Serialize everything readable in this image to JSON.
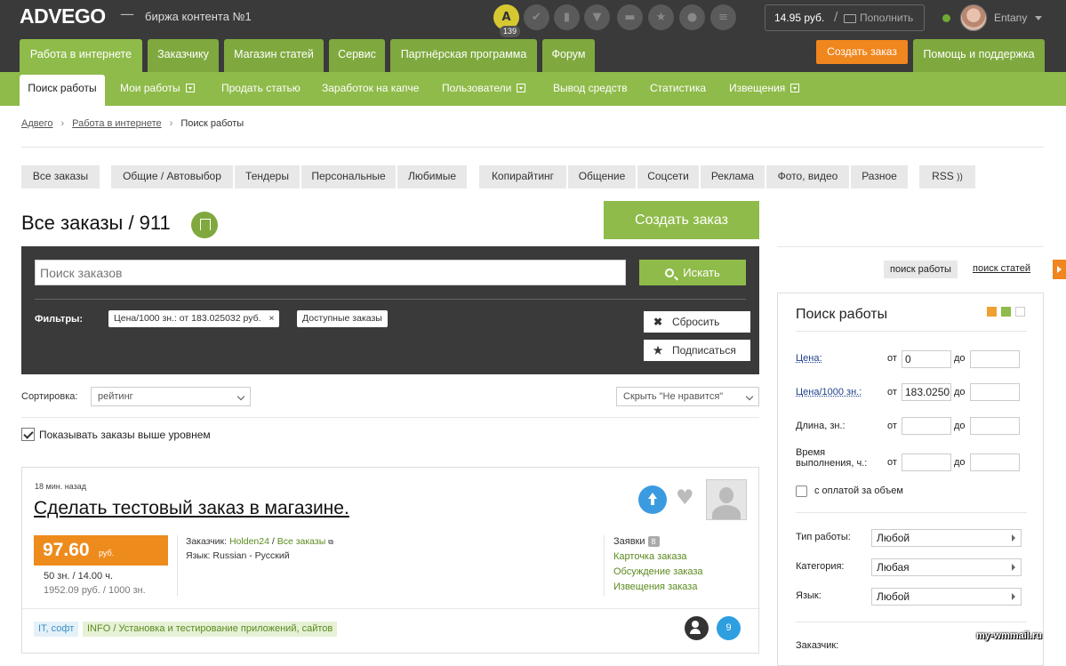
{
  "header": {
    "logo": "ADVEGO",
    "dash": "—",
    "tagline": "биржа контента №1",
    "notification_count": "139",
    "balance": "14.95 руб.",
    "balance_sep": "/",
    "topup_label": "Пополнить",
    "username": "Entany",
    "icons": [
      "doc-icon",
      "check-icon",
      "file-icon",
      "cart-icon",
      "folder-icon",
      "star-icon",
      "chat-icon",
      "list-icon"
    ]
  },
  "main_tabs": [
    "Работа в интернете",
    "Заказчику",
    "Магазин статей",
    "Сервис",
    "Партнёрская программа",
    "Форум"
  ],
  "create_order_top": "Создать заказ",
  "help_tab": "Помощь и поддержка",
  "subnav": [
    "Поиск работы",
    "Мои работы",
    "Продать статью",
    "Заработок на капче",
    "Пользователи",
    "Вывод средств",
    "Статистика",
    "Извещения"
  ],
  "breadcrumb": [
    "Адвего",
    "Работа в интернете",
    "Поиск работы"
  ],
  "breadcrumb_sep": "›",
  "filter_buttons": {
    "all": "Все заказы",
    "group1": [
      "Общие / Автовыбор",
      "Тендеры",
      "Персональные",
      "Любимые"
    ],
    "group2": [
      "Копирайтинг",
      "Общение",
      "Соцсети",
      "Реклама",
      "Фото, видео",
      "Разное"
    ],
    "rss": "RSS"
  },
  "page_title": "Все заказы / 911",
  "create_order_button": "Создать заказ",
  "search": {
    "placeholder": "Поиск заказов",
    "button": "Искать",
    "filters_label": "Фильтры:",
    "chip_price": "Цена/1000 зн.: от 183.025032 руб.",
    "chip_close": "×",
    "chip_available": "Доступные заказы",
    "reset": "Сбросить",
    "subscribe": "Подписаться"
  },
  "sort": {
    "label": "Сортировка:",
    "value": "рейтинг",
    "hide_value": "Скрыть \"Не нравится\""
  },
  "show_above_label": "Показывать заказы выше уровнем",
  "order": {
    "time": "18 мин. назад",
    "title": "Сделать тестовый заказ в магазине.",
    "price": "97.60",
    "currency": "руб.",
    "volume": "50 зн.  /  14.00 ч.",
    "price_per_1000": "1952.09 руб.  /  1000 зн.",
    "customer_label": "Заказчик:",
    "customer": "Holden24",
    "all_orders": "Все заказы",
    "language_label": "Язык:",
    "language": "Russian - Русский",
    "applications_label": "Заявки",
    "applications_count": "8",
    "links": [
      "Карточка заказа",
      "Обсуждение заказа",
      "Извещения заказа"
    ],
    "tag_category": "IT, софт",
    "tag_subcategory": "INFO / Установка и тестирование приложений, сайтов",
    "level": "9"
  },
  "sidebar": {
    "tab_jobs": "поиск работы",
    "tab_articles": "поиск статей",
    "title": "Поиск работы",
    "color_squares": [
      "#f0a030",
      "#8fbb4a",
      "#ffffff"
    ],
    "price_label": "Цена:",
    "price_per_1000_label": "Цена/1000 зн.:",
    "length_label": "Длина, зн.:",
    "time_label_1": "Время",
    "time_label_2": "выполнения, ч.:",
    "from": "от",
    "to": "до",
    "price_from": "0",
    "price_per_1000_from": "183.0250",
    "volume_payment": "с оплатой за объем",
    "job_type_label": "Тип работы:",
    "job_type_value": "Любой",
    "category_label": "Категория:",
    "category_value": "Любая",
    "language_label": "Язык:",
    "language_value": "Любой",
    "customer_label": "Заказчик:"
  },
  "watermark": "my-wmmail.ru",
  "colors": {
    "green": "#8fbb4a",
    "green_dark": "#7fa93e",
    "orange": "#f0861e",
    "dark": "#3a3a3a",
    "blue": "#3b9be0"
  }
}
